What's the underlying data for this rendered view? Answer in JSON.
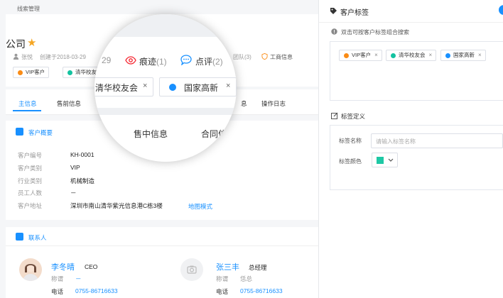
{
  "breadcrumb": "线索管理",
  "company_title": "公司",
  "meta": {
    "owner": "张悦",
    "created": "创建于2018-03-29",
    "team": "团队(3)",
    "business_info": "工商信息"
  },
  "tags": [
    {
      "label": "VIP客户",
      "color": "#fa8c16"
    },
    {
      "label": "清华校友会",
      "color": "#13c2a0"
    },
    {
      "label": "国家高新",
      "color": "#1890ff"
    }
  ],
  "tabs": [
    "主信息",
    "售前信息",
    "售中信息",
    "合同信",
    "操作日志"
  ],
  "overview": {
    "title": "客户概要",
    "rows": [
      {
        "label": "客户编号",
        "value": "KH-0001"
      },
      {
        "label": "客户类别",
        "value": "VIP"
      },
      {
        "label": "行业类别",
        "value": "机械制造"
      },
      {
        "label": "员工人数",
        "value": "－"
      },
      {
        "label": "客户地址",
        "value": "深圳市南山清华紫光信息港C栋3楼"
      }
    ],
    "map_link": "地图模式"
  },
  "contacts": {
    "title": "联系人",
    "people": [
      {
        "name": "李冬晴",
        "role": "CEO",
        "salutation_label": "称谓",
        "salutation": "－",
        "phone_label": "电话",
        "phone": "0755-86716633"
      },
      {
        "name": "张三丰",
        "role": "总经理",
        "salutation_label": "称谓",
        "salutation": "恁总",
        "phone_label": "电话",
        "phone": "0755-86716633"
      }
    ]
  },
  "lens": {
    "count": "29",
    "trace": "痕迹",
    "trace_count": "(1)",
    "comment": "点评",
    "comment_count": "(2)"
  },
  "panel": {
    "title": "客户标签",
    "hint": "双击可按客户标签组合搜索",
    "define_title": "标签定义",
    "name_label": "标签名称",
    "name_placeholder": "请输入标签名称",
    "color_label": "标签颜色",
    "color_value": "#1ec8a5"
  }
}
